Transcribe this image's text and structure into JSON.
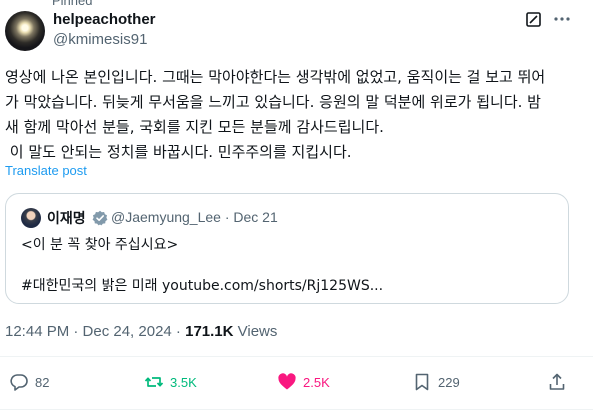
{
  "pinned_label": "Pinned",
  "author": {
    "display_name": "helpeachother",
    "handle": "@kmimesis91"
  },
  "tweet": {
    "lines": [
      "영상에 나온 본인입니다. 그때는 막아야한다는 생각밖에 없었고, 움직이는 걸 보고 뛰어",
      "가 막았습니다. 뒤늦게 무서움을 느끼고 있습니다. 응원의 말 덕분에 위로가 됩니다. 밤",
      "새 함께 막아선 분들, 국회를 지킨 모든 분들께 감사드립니다.",
      " 이 말도 안되는 정치를 바꿉시다. 민주주의를 지킵시다."
    ],
    "translate_label": "Translate post"
  },
  "quote": {
    "display_name": "이재명",
    "meta": "@Jaemyung_Lee · Dec 21",
    "line1": "<이 분 꼭 찾아 주십시요>",
    "line2": "#대한민국의 밝은 미래 youtube.com/shorts/Rj125WS..."
  },
  "timestamp": {
    "time_date": "12:44 PM · Dec 24, 2024 · ",
    "views_count": "171.1K",
    "views_label": " Views"
  },
  "actions": {
    "replies": "82",
    "reposts": "3.5K",
    "likes": "2.5K",
    "bookmarks": "229"
  },
  "icons": {
    "grok": "grok-icon",
    "more": "more-icon",
    "verified": "verified-badge-icon",
    "reply": "reply-icon",
    "repost": "repost-icon",
    "like": "heart-icon",
    "bookmark": "bookmark-icon",
    "share": "share-icon"
  },
  "colors": {
    "accent": "#1d9bf0",
    "repost_active": "#00ba7c",
    "like_active": "#f91880",
    "muted": "#536471",
    "border": "#cfd9de",
    "verified": "#829aab"
  }
}
